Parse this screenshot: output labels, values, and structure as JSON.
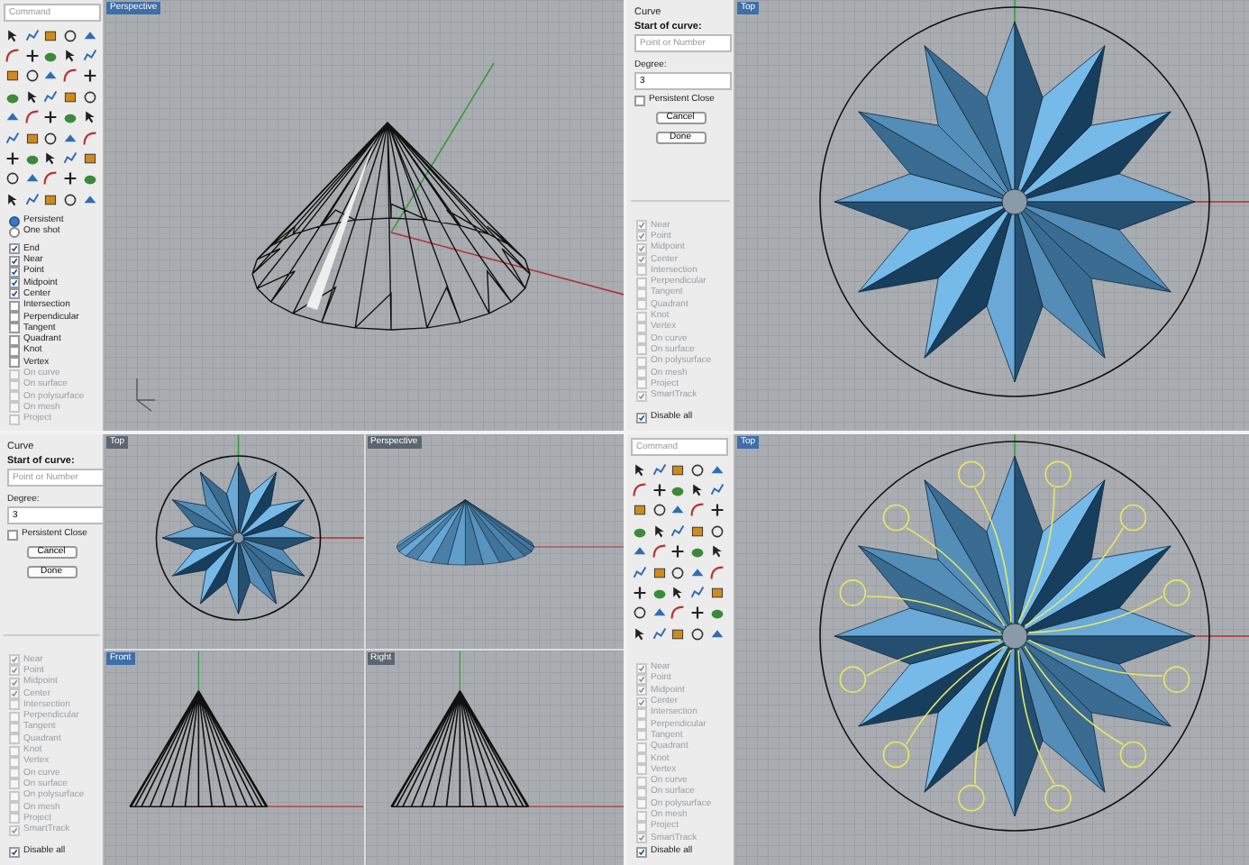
{
  "panels": [
    {
      "sidebar": {
        "kind": "toolbox",
        "command": {
          "placeholder": "Command"
        },
        "snap_modes": [
          {
            "label": "Persistent",
            "selected": true
          },
          {
            "label": "One shot",
            "selected": false
          }
        ],
        "osnaps": [
          {
            "label": "End",
            "checked": true,
            "disabled": false
          },
          {
            "label": "Near",
            "checked": true,
            "disabled": false
          },
          {
            "label": "Point",
            "checked": true,
            "disabled": false
          },
          {
            "label": "Midpoint",
            "checked": true,
            "disabled": false
          },
          {
            "label": "Center",
            "checked": true,
            "disabled": false
          },
          {
            "label": "Intersection",
            "checked": false,
            "disabled": false
          },
          {
            "label": "Perpendicular",
            "checked": false,
            "disabled": false
          },
          {
            "label": "Tangent",
            "checked": false,
            "disabled": false
          },
          {
            "label": "Quadrant",
            "checked": false,
            "disabled": false
          },
          {
            "label": "Knot",
            "checked": false,
            "disabled": false
          },
          {
            "label": "Vertex",
            "checked": false,
            "disabled": false
          },
          {
            "label": "On curve",
            "checked": false,
            "disabled": true
          },
          {
            "label": "On surface",
            "checked": false,
            "disabled": true
          },
          {
            "label": "On polysurface",
            "checked": false,
            "disabled": true
          },
          {
            "label": "On mesh",
            "checked": false,
            "disabled": true
          },
          {
            "label": "Project",
            "checked": false,
            "disabled": true
          }
        ]
      },
      "viewports": [
        {
          "title": "Perspective",
          "selected": true,
          "kind": "cone-wire"
        }
      ]
    },
    {
      "sidebar": {
        "kind": "curve",
        "curve": {
          "title": "Curve",
          "prompt": "Start of curve:",
          "point_field": {
            "placeholder": "Point or Number"
          },
          "degree_label": "Degree:",
          "degree_field": {
            "value": "3"
          },
          "persistent_close": {
            "label": "Persistent Close",
            "checked": false
          },
          "buttons": [
            "Cancel",
            "Done"
          ]
        },
        "osnaps": [
          {
            "label": "Near",
            "checked": true,
            "disabled": true
          },
          {
            "label": "Point",
            "checked": true,
            "disabled": true
          },
          {
            "label": "Midpoint",
            "checked": true,
            "disabled": true
          },
          {
            "label": "Center",
            "checked": true,
            "disabled": true
          },
          {
            "label": "Intersection",
            "checked": false,
            "disabled": true
          },
          {
            "label": "Perpendicular",
            "checked": false,
            "disabled": true
          },
          {
            "label": "Tangent",
            "checked": false,
            "disabled": true
          },
          {
            "label": "Quadrant",
            "checked": false,
            "disabled": true
          },
          {
            "label": "Knot",
            "checked": false,
            "disabled": true
          },
          {
            "label": "Vertex",
            "checked": false,
            "disabled": true
          },
          {
            "label": "On curve",
            "checked": false,
            "disabled": true
          },
          {
            "label": "On surface",
            "checked": false,
            "disabled": true
          },
          {
            "label": "On polysurface",
            "checked": false,
            "disabled": true
          },
          {
            "label": "On mesh",
            "checked": false,
            "disabled": true
          },
          {
            "label": "Project",
            "checked": false,
            "disabled": true
          },
          {
            "label": "SmartTrack",
            "checked": true,
            "disabled": true
          }
        ],
        "disable_all": {
          "label": "Disable all",
          "checked": true
        }
      },
      "viewports": [
        {
          "title": "Top",
          "selected": true,
          "kind": "star-top"
        }
      ]
    },
    {
      "sidebar": {
        "kind": "curve",
        "curve": {
          "title": "Curve",
          "prompt": "Start of curve:",
          "point_field": {
            "placeholder": "Point or Number"
          },
          "degree_label": "Degree:",
          "degree_field": {
            "value": "3"
          },
          "persistent_close": {
            "label": "Persistent Close",
            "checked": false
          },
          "buttons": [
            "Cancel",
            "Done"
          ]
        },
        "osnaps": [
          {
            "label": "Near",
            "checked": true,
            "disabled": true
          },
          {
            "label": "Point",
            "checked": true,
            "disabled": true
          },
          {
            "label": "Midpoint",
            "checked": true,
            "disabled": true
          },
          {
            "label": "Center",
            "checked": true,
            "disabled": true
          },
          {
            "label": "Intersection",
            "checked": false,
            "disabled": true
          },
          {
            "label": "Perpendicular",
            "checked": false,
            "disabled": true
          },
          {
            "label": "Tangent",
            "checked": false,
            "disabled": true
          },
          {
            "label": "Quadrant",
            "checked": false,
            "disabled": true
          },
          {
            "label": "Knot",
            "checked": false,
            "disabled": true
          },
          {
            "label": "Vertex",
            "checked": false,
            "disabled": true
          },
          {
            "label": "On curve",
            "checked": false,
            "disabled": true
          },
          {
            "label": "On surface",
            "checked": false,
            "disabled": true
          },
          {
            "label": "On polysurface",
            "checked": false,
            "disabled": true
          },
          {
            "label": "On mesh",
            "checked": false,
            "disabled": true
          },
          {
            "label": "Project",
            "checked": false,
            "disabled": true
          },
          {
            "label": "SmartTrack",
            "checked": true,
            "disabled": true
          }
        ],
        "disable_all": {
          "label": "Disable all",
          "checked": true
        }
      },
      "viewports": [
        {
          "title": "Top",
          "selected": false,
          "kind": "star-top"
        },
        {
          "title": "Perspective",
          "selected": false,
          "kind": "cone-shaded"
        },
        {
          "title": "Front",
          "selected": true,
          "kind": "cone-side"
        },
        {
          "title": "Right",
          "selected": false,
          "kind": "cone-side"
        }
      ]
    },
    {
      "sidebar": {
        "kind": "toolbox",
        "command": {
          "placeholder": "Command"
        },
        "osnaps": [
          {
            "label": "Near",
            "checked": true,
            "disabled": true
          },
          {
            "label": "Point",
            "checked": true,
            "disabled": true
          },
          {
            "label": "Midpoint",
            "checked": true,
            "disabled": true
          },
          {
            "label": "Center",
            "checked": true,
            "disabled": true
          },
          {
            "label": "Intersection",
            "checked": false,
            "disabled": true
          },
          {
            "label": "Perpendicular",
            "checked": false,
            "disabled": true
          },
          {
            "label": "Tangent",
            "checked": false,
            "disabled": true
          },
          {
            "label": "Quadrant",
            "checked": false,
            "disabled": true
          },
          {
            "label": "Knot",
            "checked": false,
            "disabled": true
          },
          {
            "label": "Vertex",
            "checked": false,
            "disabled": true
          },
          {
            "label": "On curve",
            "checked": false,
            "disabled": true
          },
          {
            "label": "On surface",
            "checked": false,
            "disabled": true
          },
          {
            "label": "On polysurface",
            "checked": false,
            "disabled": true
          },
          {
            "label": "On mesh",
            "checked": false,
            "disabled": true
          },
          {
            "label": "Project",
            "checked": false,
            "disabled": true
          },
          {
            "label": "SmartTrack",
            "checked": true,
            "disabled": true
          }
        ],
        "disable_all": {
          "label": "Disable all",
          "checked": true
        }
      },
      "viewports": [
        {
          "title": "Top",
          "selected": true,
          "kind": "star-curves"
        }
      ]
    }
  ]
}
